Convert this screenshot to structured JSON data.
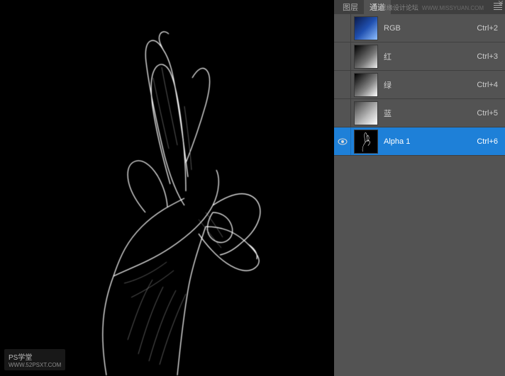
{
  "header": {
    "tabs": [
      "图层",
      "通道"
    ],
    "active_tab": 1,
    "watermark_top": "思缘设计论坛",
    "watermark_url": "WWW.MISSYUAN.COM"
  },
  "channels": [
    {
      "name": "RGB",
      "shortcut": "Ctrl+2",
      "visible": false,
      "selected": false,
      "thumb_class": "rgb"
    },
    {
      "name": "红",
      "shortcut": "Ctrl+3",
      "visible": false,
      "selected": false,
      "thumb_class": "red"
    },
    {
      "name": "绿",
      "shortcut": "Ctrl+4",
      "visible": false,
      "selected": false,
      "thumb_class": "green"
    },
    {
      "name": "蓝",
      "shortcut": "Ctrl+5",
      "visible": false,
      "selected": false,
      "thumb_class": "blue"
    },
    {
      "name": "Alpha 1",
      "shortcut": "Ctrl+6",
      "visible": true,
      "selected": true,
      "thumb_class": "alpha"
    }
  ],
  "watermark_bottom": {
    "title": "PS学堂",
    "url": "WWW.52PSXT.COM"
  }
}
